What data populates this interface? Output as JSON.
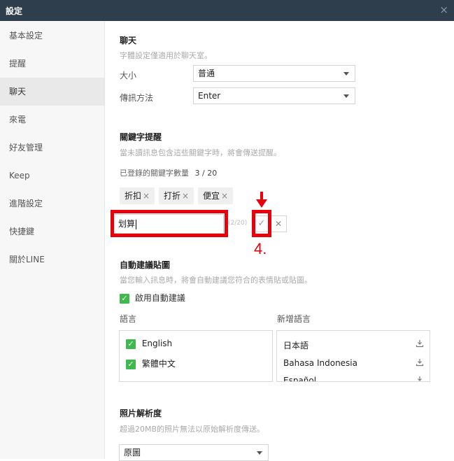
{
  "window": {
    "title": "設定",
    "close_glyph": "×"
  },
  "sidebar": {
    "items": [
      {
        "label": "基本設定",
        "active": false
      },
      {
        "label": "提醒",
        "active": false
      },
      {
        "label": "聊天",
        "active": true
      },
      {
        "label": "來電",
        "active": false
      },
      {
        "label": "好友管理",
        "active": false
      },
      {
        "label": "Keep",
        "active": false
      },
      {
        "label": "進階設定",
        "active": false
      },
      {
        "label": "快捷鍵",
        "active": false
      },
      {
        "label": "關於LINE",
        "active": false
      }
    ]
  },
  "chat": {
    "title": "聊天",
    "font_note": "字體設定僅適用於聊天室。",
    "size_label": "大小",
    "size_value": "普通",
    "send_label": "傳訊方法",
    "send_value": "Enter"
  },
  "keywords": {
    "title": "關鍵字提醒",
    "desc": "當未讀訊息包含這些關鍵字時，將會傳送提醒。",
    "count_label": "已登錄的關鍵字數量",
    "count_value": "3 / 20",
    "tags": [
      "折扣",
      "打折",
      "便宜"
    ],
    "tag_remove_glyph": "×",
    "input_value": "划算",
    "char_count": "(2/20)",
    "confirm_glyph": "✓",
    "cancel_glyph": "✕",
    "annotation": "4."
  },
  "stickers": {
    "title": "自動建議貼圖",
    "desc": "當您輸入訊息時，將會自動建議您符合的表情貼或貼圖。",
    "enable_label": "啟用自動建議",
    "languages_label": "語言",
    "add_languages_label": "新增語言",
    "languages": [
      "English",
      "繁體中文"
    ],
    "available": [
      "日本語",
      "Bahasa Indonesia",
      "Español"
    ]
  },
  "photo": {
    "title": "照片解析度",
    "desc": "超過20MB的照片無法以原始解析度傳送。",
    "value": "原圖"
  },
  "colors": {
    "titlebar": "#2f3e4d",
    "check_green": "#3fb94e",
    "highlight_red": "#e8000b"
  }
}
